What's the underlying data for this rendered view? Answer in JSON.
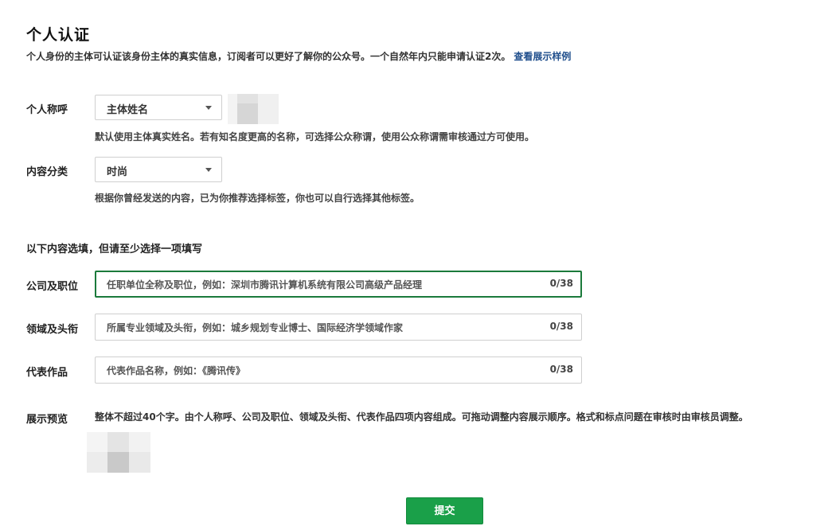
{
  "header": {
    "title": "个人认证",
    "description": "个人身份的主体可认证该身份主体的真实信息，订阅者可以更好了解你的公众号。一个自然年内只能申请认证2次。",
    "sample_link": "查看展示样例"
  },
  "personal_title": {
    "label": "个人称呼",
    "selected": "主体姓名",
    "hint": "默认使用主体真实姓名。若有知名度更高的名称，可选择公众称谓，使用公众称谓需审核通过方可使用。"
  },
  "content_category": {
    "label": "内容分类",
    "selected": "时尚",
    "hint": "根据你曾经发送的内容，已为你推荐选择标签，你也可以自行选择其他标签。"
  },
  "optional_note": "以下内容选填，但请至少选择一项填写",
  "fields": [
    {
      "label": "公司及职位",
      "placeholder": "任职单位全称及职位，例如：深圳市腾讯计算机系统有限公司高级产品经理",
      "count": "0/38"
    },
    {
      "label": "领域及头衔",
      "placeholder": "所属专业领域及头衔，例如：城乡规划专业博士、国际经济学领域作家",
      "count": "0/38"
    },
    {
      "label": "代表作品",
      "placeholder": "代表作品名称，例如：《腾讯传》",
      "count": "0/38"
    }
  ],
  "preview": {
    "label": "展示预览",
    "text": "整体不超过40个字。由个人称呼、公司及职位、领域及头衔、代表作品四项内容组成。可拖动调整内容展示顺序。格式和标点问题在审核时由审核员调整。"
  },
  "submit_label": "提交"
}
